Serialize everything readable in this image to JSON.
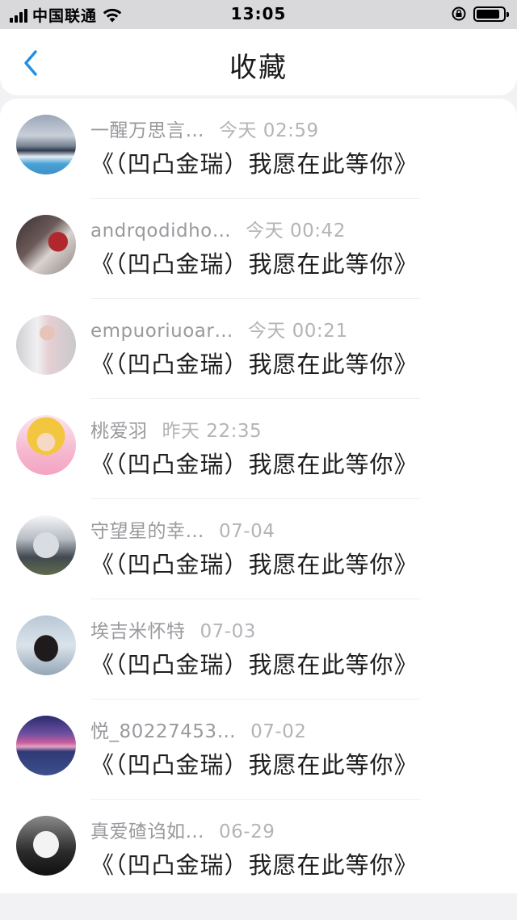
{
  "status_bar": {
    "carrier": "中国联通",
    "time": "13:05"
  },
  "nav": {
    "title": "收藏",
    "back_icon": "chevron-left-icon",
    "accent_color": "#1e8fe8"
  },
  "favorites": [
    {
      "user": "一醒万思言…",
      "time": "今天 02:59",
      "song": "《（凹凸金瑞）我愿在此等你》"
    },
    {
      "user": "andrqodidho…",
      "time": "今天 00:42",
      "song": "《（凹凸金瑞）我愿在此等你》"
    },
    {
      "user": "empuoriuoar…",
      "time": "今天 00:21",
      "song": "《（凹凸金瑞）我愿在此等你》"
    },
    {
      "user": "桃爱羽",
      "time": "昨天 22:35",
      "song": "《（凹凸金瑞）我愿在此等你》"
    },
    {
      "user": "守望星的幸…",
      "time": "07-04",
      "song": "《（凹凸金瑞）我愿在此等你》"
    },
    {
      "user": "埃吉米怀特",
      "time": "07-03",
      "song": "《（凹凸金瑞）我愿在此等你》"
    },
    {
      "user": "悦_80227453…",
      "time": "07-02",
      "song": "《（凹凸金瑞）我愿在此等你》"
    },
    {
      "user": "真爱碴诌如…",
      "time": "06-29",
      "song": "《（凹凸金瑞）我愿在此等你》"
    }
  ]
}
